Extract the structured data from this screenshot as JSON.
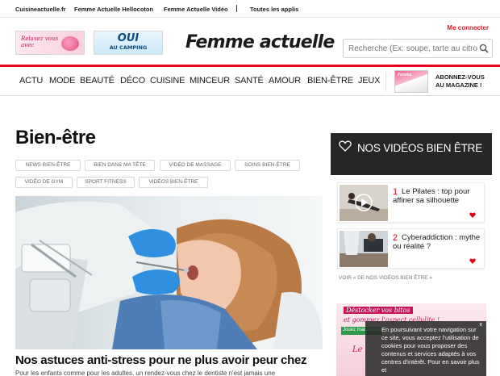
{
  "topbar": {
    "links": [
      "Cuisineactuelle.fr",
      "Femme Actuelle Hellocoton",
      "Femme Actuelle Vidéo",
      "Toutes les applis"
    ]
  },
  "header": {
    "promo1_text": "Relaxez vous avec",
    "promo2_big": "OUI",
    "promo2_small": "AU CAMPING",
    "logo": "Femme actuelle",
    "connect": "Me connecter",
    "search_placeholder": "Recherche (Ex: soupe, tarte au citron...)"
  },
  "nav": {
    "items": [
      "ACTU",
      "MODE",
      "BEAUTÉ",
      "DÉCO",
      "CUISINE",
      "MINCEUR",
      "SANTÉ",
      "AMOUR",
      "BIEN-ÊTRE",
      "JEUX"
    ],
    "subscribe": [
      "ABONNEZ-VOUS",
      "AU MAGAZINE !"
    ]
  },
  "main": {
    "title": "Bien-être",
    "tags": [
      "NEWS BIEN-ÊTRE",
      "BIEN DANS MA TÊTE",
      "VIDÉO DE MASSAGE",
      "SOINS BIEN-ÊTRE",
      "VIDÉO DE GYM",
      "SPORT FITNESS",
      "VIDÉOS BIEN-ÊTRE"
    ],
    "headline": "Nos astuces anti-stress pour ne plus avoir peur chez",
    "excerpt": "Pour les enfants comme pour les adultes, un rendez-vous chez le dentiste n'est jamais une"
  },
  "sidebar": {
    "videos_title": "NOS VIDÉOS BIEN ÊTRE",
    "videos": [
      {
        "num": "1",
        "title": "Le Pilates : top pour affiner sa silhouette"
      },
      {
        "num": "2",
        "title": "Cyberaddiction : mythe ou réalité ?"
      }
    ],
    "more": "VOIR « DE NOS VIDÉOS BIEN ÊTRE »"
  },
  "ad": {
    "line1": "Déstocker vos bitos",
    "line2": "et gommez l'aspect cellulite !",
    "shop": "Jouez maintenant",
    "logo": "Le"
  },
  "cookie": {
    "text": "En poursuivant votre navigation sur ce site, vous acceptez l'utilisation de cookies pour vous proposer des contenus et services adaptés à vos centres d'intérêt. Pour en savoir plus et",
    "close": "x"
  },
  "colors": {
    "brand_red": "#e3001b",
    "dark_panel": "#262626"
  }
}
